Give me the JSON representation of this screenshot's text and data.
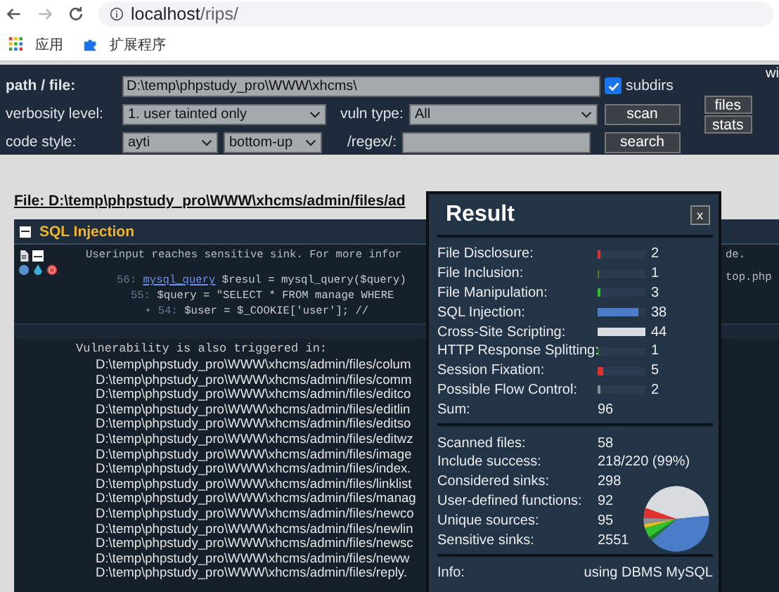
{
  "browser": {
    "url_host": "localhost",
    "url_path": "/rips/",
    "bookmarks": [
      {
        "kind": "apps",
        "label": "应用"
      },
      {
        "kind": "extension",
        "label": "扩展程序"
      }
    ]
  },
  "toolbar": {
    "path_label": "path / file:",
    "path_value": "D:\\temp\\phpstudy_pro\\WWW\\xhcms\\",
    "subdirs": {
      "label": "subdirs",
      "checked": true
    },
    "verbosity_label": "verbosity level:",
    "verbosity_value": "1. user tainted only",
    "vuln_label": "vuln type:",
    "vuln_value": "All",
    "scan": "scan",
    "style_label": "code style:",
    "style_value": "ayti",
    "order_value": "bottom-up",
    "regex_label": "/regex/:",
    "search": "search",
    "corner_text": "wi",
    "files": "files",
    "stats": "stats"
  },
  "file_heading": "File: D:\\temp\\phpstudy_pro\\WWW\\xhcms/admin/files/ad",
  "panel": {
    "title": "SQL Injection",
    "message": "Userinput reaches sensitive sink. For more infor",
    "message_tail": "de.",
    "code_lines": [
      {
        "line": "56:",
        "sink": "mysql_query",
        "code": " $resul = mysql_query($query)",
        "tail": "top.php"
      },
      {
        "line": "55:",
        "code": " $query = \"SELECT * FROM manage WHERE"
      },
      {
        "line": "• 54:",
        "code": " $user = $_COOKIE['user'];  //"
      }
    ],
    "also_label": "Vulnerability is also triggered in:",
    "also_paths": [
      "D:\\temp\\phpstudy_pro\\WWW\\xhcms/admin/files/colum",
      "D:\\temp\\phpstudy_pro\\WWW\\xhcms/admin/files/comm",
      "D:\\temp\\phpstudy_pro\\WWW\\xhcms/admin/files/editco",
      "D:\\temp\\phpstudy_pro\\WWW\\xhcms/admin/files/editlin",
      "D:\\temp\\phpstudy_pro\\WWW\\xhcms/admin/files/editso",
      "D:\\temp\\phpstudy_pro\\WWW\\xhcms/admin/files/editwz",
      "D:\\temp\\phpstudy_pro\\WWW\\xhcms/admin/files/image",
      "D:\\temp\\phpstudy_pro\\WWW\\xhcms/admin/files/index.",
      "D:\\temp\\phpstudy_pro\\WWW\\xhcms/admin/files/linklist",
      "D:\\temp\\phpstudy_pro\\WWW\\xhcms/admin/files/manag",
      "D:\\temp\\phpstudy_pro\\WWW\\xhcms/admin/files/newco",
      "D:\\temp\\phpstudy_pro\\WWW\\xhcms/admin/files/newlin",
      "D:\\temp\\phpstudy_pro\\WWW\\xhcms/admin/files/newsc",
      "D:\\temp\\phpstudy_pro\\WWW\\xhcms/admin/files/neww",
      "D:\\temp\\phpstudy_pro\\WWW\\xhcms/admin/files/reply."
    ]
  },
  "result": {
    "title": "Result",
    "close": "x",
    "vulns": [
      {
        "label": "File Disclosure:",
        "count": "2",
        "level": 0.05,
        "color": "#e03030"
      },
      {
        "label": "File Inclusion:",
        "count": "1",
        "level": 0.03,
        "color": "#6b7030"
      },
      {
        "label": "File Manipulation:",
        "count": "3",
        "level": 0.07,
        "color": "#30c030"
      },
      {
        "label": "SQL Injection:",
        "count": "38",
        "level": 0.86,
        "color": "#4a7cc8"
      },
      {
        "label": "Cross-Site Scripting:",
        "count": "44",
        "level": 1,
        "color": "#d8dce0"
      },
      {
        "label": "HTTP Response Splitting:",
        "count": "1",
        "level": 0.03,
        "color": "#207a30"
      },
      {
        "label": "Session Fixation:",
        "count": "5",
        "level": 0.11,
        "color": "#e03030"
      },
      {
        "label": "Possible Flow Control:",
        "count": "2",
        "level": 0.05,
        "color": "#8a9098"
      }
    ],
    "sum_label": "Sum:",
    "sum": "96",
    "stats": [
      {
        "label": "Scanned files:",
        "value": "58"
      },
      {
        "label": "Include success:",
        "value": "218/220 (99%)"
      },
      {
        "label": "Considered sinks:",
        "value": "298"
      },
      {
        "label": "User-defined functions:",
        "value": "92"
      },
      {
        "label": "Unique sources:",
        "value": "95"
      },
      {
        "label": "Sensitive sinks:",
        "value": "2551"
      }
    ],
    "info_label": "Info:",
    "info": "using DBMS MySQL"
  }
}
